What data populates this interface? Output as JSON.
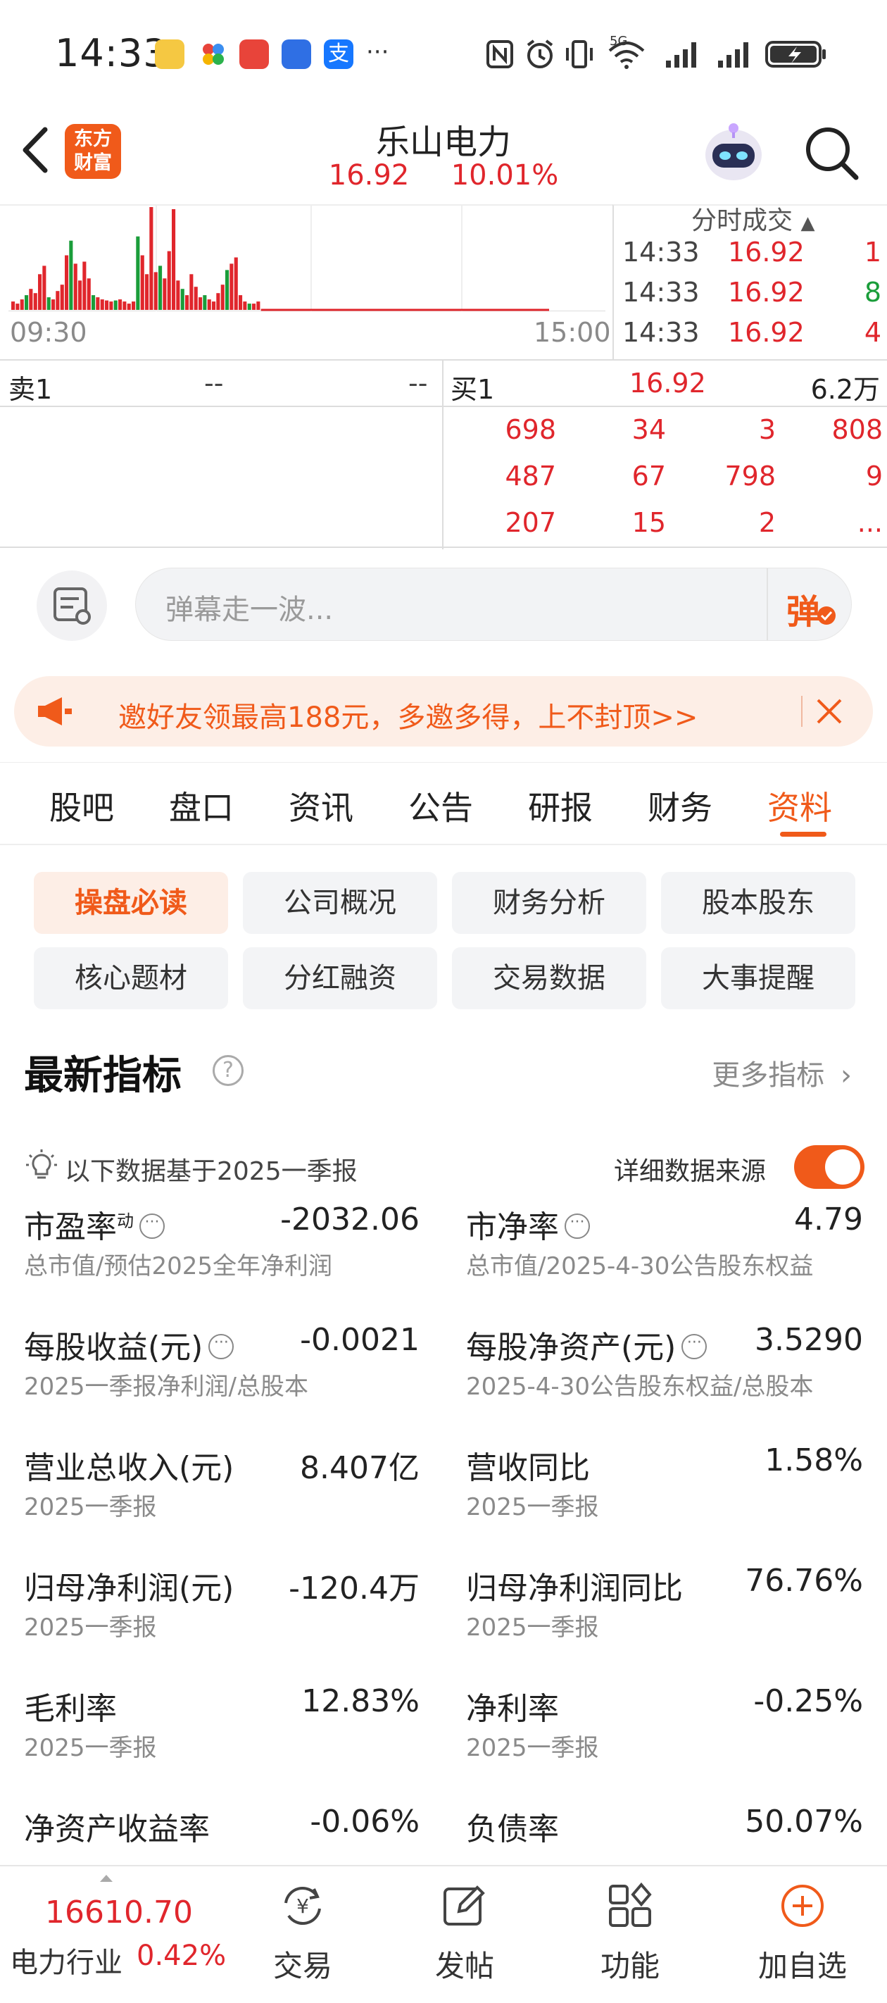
{
  "status_bar": {
    "time": "14:33",
    "more": "···",
    "network": "5G"
  },
  "header": {
    "stock_name": "乐山电力",
    "price": "16.92",
    "change_pct": "10.01%",
    "logo_line1": "东方",
    "logo_line2": "财富"
  },
  "chart": {
    "time_start": "09:30",
    "time_end": "15:00",
    "volume_bars": [
      8,
      6,
      10,
      14,
      20,
      16,
      34,
      42,
      12,
      10,
      18,
      24,
      52,
      66,
      44,
      28,
      46,
      30,
      14,
      12,
      10,
      9,
      8,
      9,
      10,
      8,
      6,
      8,
      70,
      52,
      34,
      98,
      36,
      42,
      30,
      56,
      96,
      28,
      20,
      14,
      34,
      22,
      12,
      14,
      10,
      8,
      16,
      24,
      38,
      44,
      50,
      14,
      8,
      6,
      6,
      8
    ]
  },
  "ticks": {
    "header": "分时成交",
    "rows": [
      {
        "time": "14:33",
        "price": "16.92",
        "volume": "1",
        "dir": "up"
      },
      {
        "time": "14:33",
        "price": "16.92",
        "volume": "8",
        "dir": "down"
      },
      {
        "time": "14:33",
        "price": "16.92",
        "volume": "4",
        "dir": "up"
      }
    ]
  },
  "order_book": {
    "sell1_label": "卖1",
    "sell1_price": "--",
    "sell1_volume": "--",
    "buy1_label": "买1",
    "buy1_price": "16.92",
    "buy1_volume": "6.2万",
    "queue": [
      [
        "698",
        "34",
        "3",
        "808"
      ],
      [
        "487",
        "67",
        "798",
        "9"
      ],
      [
        "207",
        "15",
        "2",
        "..."
      ]
    ]
  },
  "danmu": {
    "placeholder": "弹幕走一波...",
    "button": "弹"
  },
  "banner": {
    "text": "邀好友领最高188元，多邀多得，上不封顶>>"
  },
  "tabs": [
    "股吧",
    "盘口",
    "资讯",
    "公告",
    "研报",
    "财务",
    "资料"
  ],
  "active_tab": "资料",
  "chips": [
    "操盘必读",
    "公司概况",
    "财务分析",
    "股本股东",
    "核心题材",
    "分红融资",
    "交易数据",
    "大事提醒"
  ],
  "section": {
    "title": "最新指标",
    "more": "更多指标",
    "basis": "以下数据基于2025一季报",
    "source_label": "详细数据来源",
    "metrics": [
      {
        "name": "市盈率",
        "sup": "动",
        "value": "-2032.06",
        "sub": "总市值/预估2025全年净利润",
        "color": "normal"
      },
      {
        "name": "市净率",
        "value": "4.79",
        "sub": "总市值/2025-4-30公告股东权益",
        "color": "normal"
      },
      {
        "name": "每股收益(元)",
        "value": "-0.0021",
        "sub": "2025一季报净利润/总股本",
        "color": "normal"
      },
      {
        "name": "每股净资产(元)",
        "value": "3.5290",
        "sub": "2025-4-30公告股东权益/总股本",
        "color": "normal"
      },
      {
        "name": "营业总收入(元)",
        "value": "8.407亿",
        "sub": "2025一季报",
        "color": "normal"
      },
      {
        "name": "营收同比",
        "value": "1.58%",
        "sub": "2025一季报",
        "color": "red"
      },
      {
        "name": "归母净利润(元)",
        "value": "-120.4万",
        "sub": "2025一季报",
        "color": "normal"
      },
      {
        "name": "归母净利润同比",
        "value": "76.76%",
        "sub": "2025一季报",
        "color": "red"
      },
      {
        "name": "毛利率",
        "value": "12.83%",
        "sub": "2025一季报",
        "color": "normal"
      },
      {
        "name": "净利率",
        "value": "-0.25%",
        "sub": "2025一季报",
        "color": "normal"
      },
      {
        "name": "净资产收益率",
        "value": "-0.06%",
        "sub": "",
        "color": "normal"
      },
      {
        "name": "负债率",
        "value": "50.07%",
        "sub": "",
        "color": "normal"
      }
    ]
  },
  "bottom_bar": {
    "index_value": "16610.70",
    "index_name": "电力行业",
    "index_change": "0.42%",
    "items": [
      "交易",
      "发帖",
      "功能",
      "加自选"
    ]
  },
  "colors": {
    "accent": "#f05a1a",
    "up": "#e0262c",
    "down": "#1a9d3a"
  }
}
